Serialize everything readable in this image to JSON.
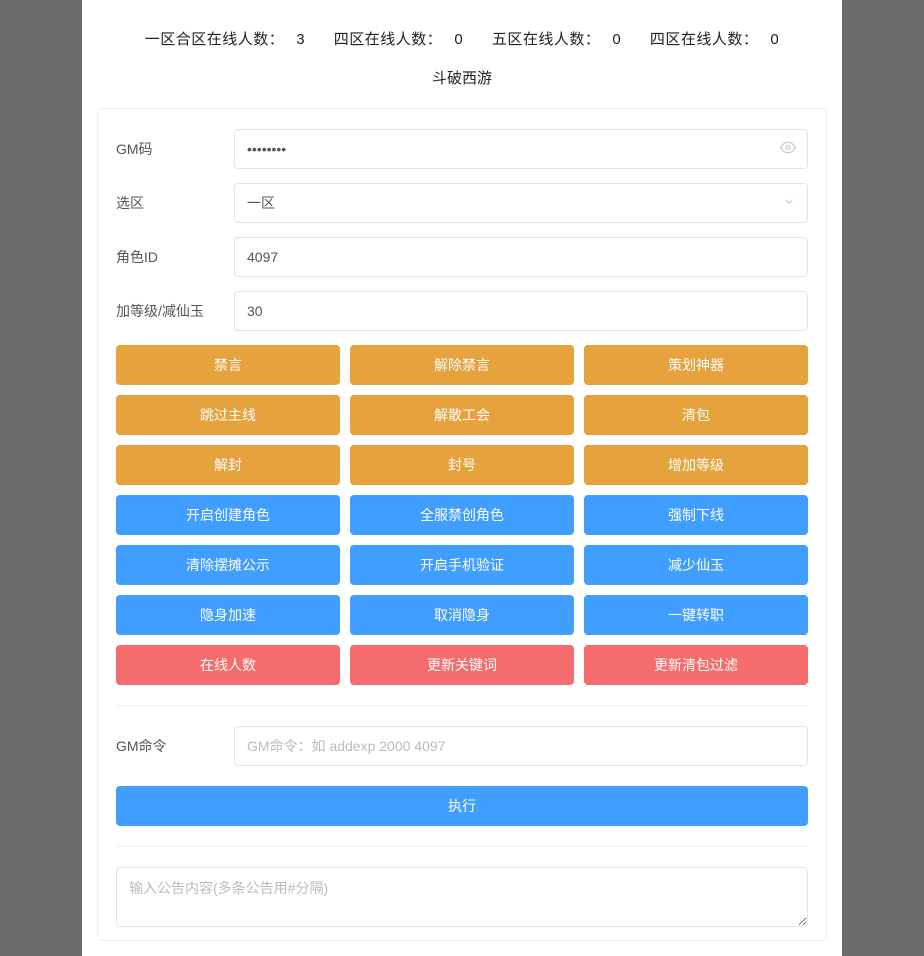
{
  "header": {
    "stats": [
      {
        "label": "一区合区在线人数：",
        "value": "3"
      },
      {
        "label": "四区在线人数：",
        "value": "0"
      },
      {
        "label": "五区在线人数：",
        "value": "0"
      },
      {
        "label": "四区在线人数：",
        "value": "0"
      }
    ],
    "subtitle": "斗破西游"
  },
  "form": {
    "gm_code": {
      "label": "GM码",
      "value": "••••••••"
    },
    "zone": {
      "label": "选区",
      "value": "一区"
    },
    "role_id": {
      "label": "角色ID",
      "value": "4097"
    },
    "level": {
      "label": "加等级/减仙玉",
      "value": "30"
    }
  },
  "buttons": {
    "orange": [
      "禁言",
      "解除禁言",
      "策划神器",
      "跳过主线",
      "解散工会",
      "清包",
      "解封",
      "封号",
      "增加等级"
    ],
    "blue": [
      "开启创建角色",
      "全服禁创角色",
      "强制下线",
      "清除摆摊公示",
      "开启手机验证",
      "减少仙玉",
      "隐身加速",
      "取消隐身",
      "一键转职"
    ],
    "red": [
      "在线人数",
      "更新关键词",
      "更新清包过滤"
    ]
  },
  "gm_command": {
    "label": "GM命令",
    "placeholder": "GM命令：如 addexp 2000 4097",
    "execute": "执行"
  },
  "announcement": {
    "placeholder": "输入公告内容(多条公告用#分隔)"
  }
}
